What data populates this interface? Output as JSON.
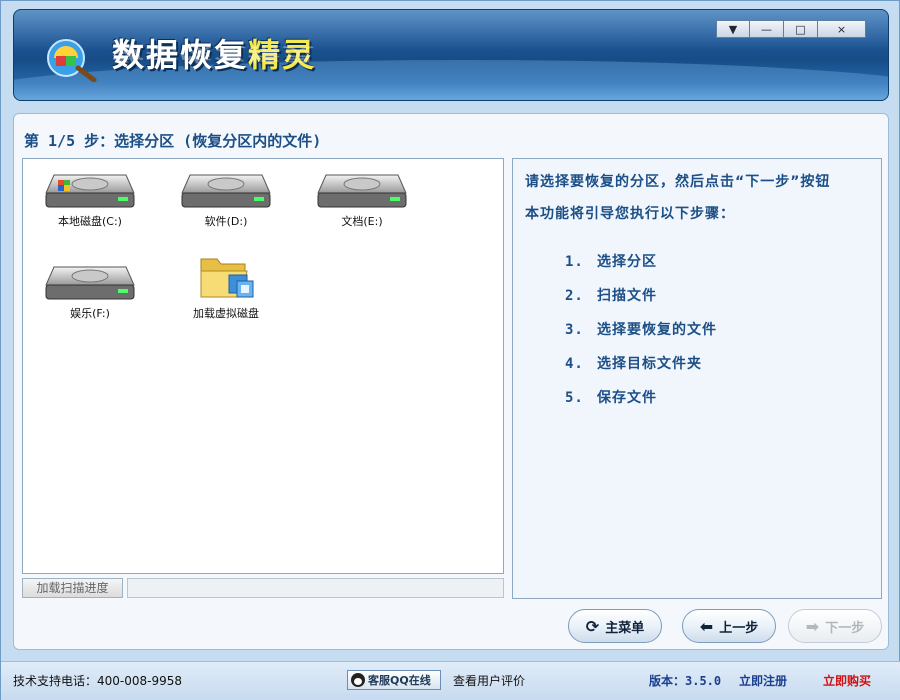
{
  "app": {
    "title_main": "数据恢复",
    "title_accent": "精灵",
    "window_controls": [
      "▼",
      "—",
      "□",
      "×"
    ]
  },
  "step": {
    "title": "第 1/5 步：选择分区 (恢复分区内的文件)"
  },
  "drives": [
    {
      "label": "本地磁盘(C:)",
      "icon": "system-drive-icon"
    },
    {
      "label": "软件(D:)",
      "icon": "hard-drive-icon"
    },
    {
      "label": "文档(E:)",
      "icon": "hard-drive-icon"
    },
    {
      "label": "娱乐(F:)",
      "icon": "hard-drive-icon"
    },
    {
      "label": "加载虚拟磁盘",
      "icon": "virtual-disk-folder-icon"
    }
  ],
  "progress": {
    "button_label": "加载扫描进度"
  },
  "info": {
    "intro": "请选择要恢复的分区，然后点击“下一步”按钮",
    "lead": "本功能将引导您执行以下步骤：",
    "steps": [
      {
        "num": "1.",
        "text": "选择分区"
      },
      {
        "num": "2.",
        "text": "扫描文件"
      },
      {
        "num": "3.",
        "text": "选择要恢复的文件"
      },
      {
        "num": "4.",
        "text": "选择目标文件夹"
      },
      {
        "num": "5.",
        "text": "保存文件"
      }
    ]
  },
  "nav": {
    "main_menu": "主菜单",
    "prev": "上一步",
    "next": "下一步"
  },
  "status": {
    "support_phone": "技术支持电话：400-008-9958",
    "qq_online": "客服QQ在线",
    "user_reviews": "查看用户评价",
    "version": "版本：3.5.0",
    "register": "立即注册",
    "buy": "立即购买"
  },
  "colors": {
    "accent_title": "#f6e94d",
    "info_text": "#1d4f87",
    "buy_red": "#d01010"
  }
}
